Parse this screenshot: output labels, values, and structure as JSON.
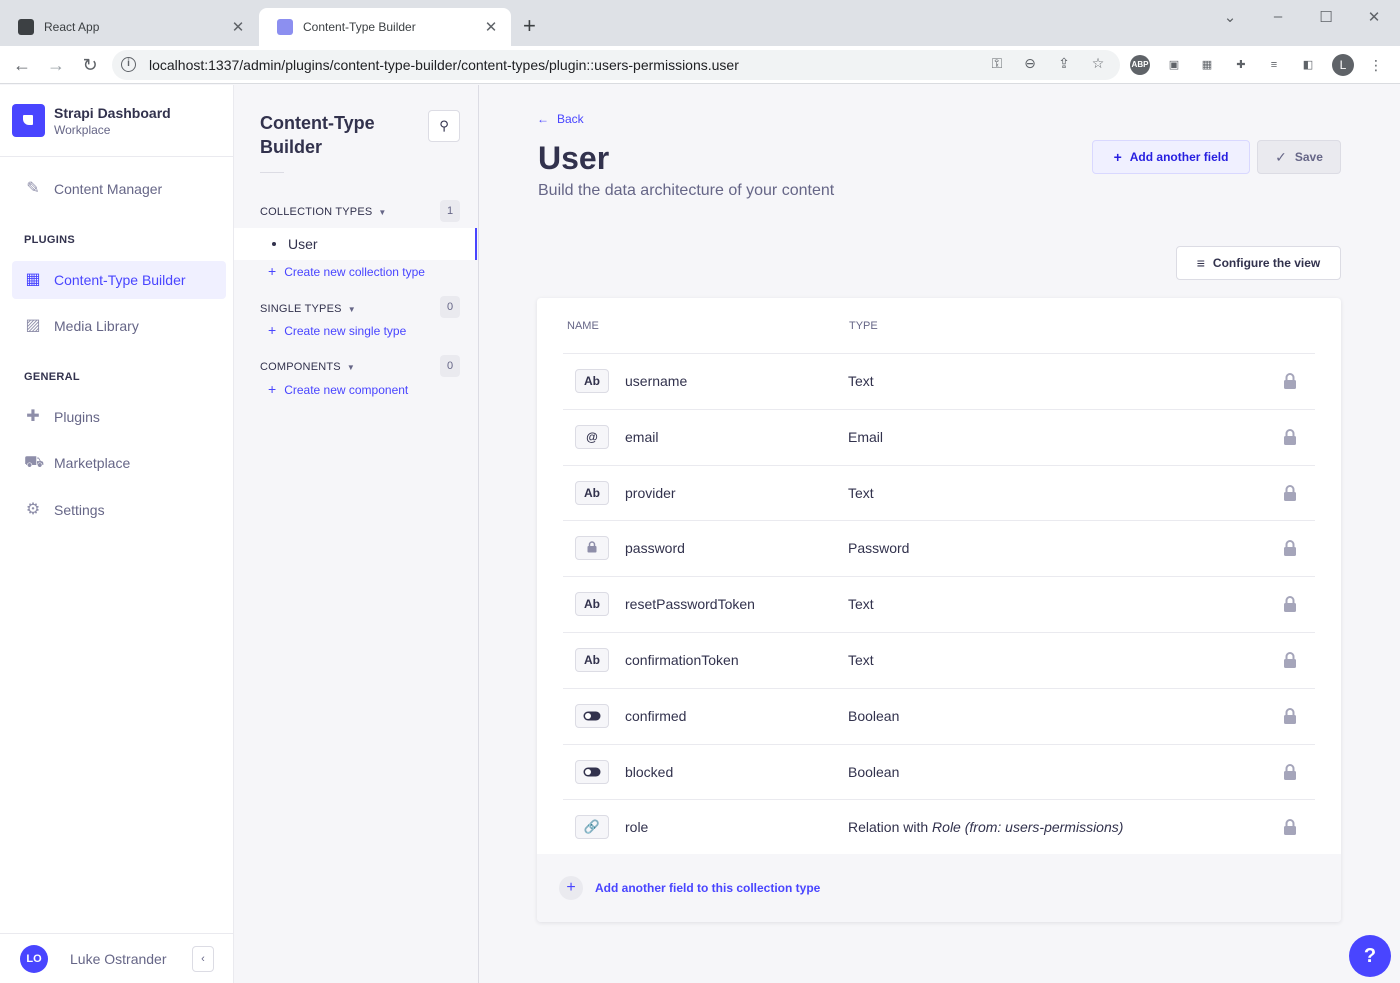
{
  "browser": {
    "tabs": [
      {
        "title": "React App"
      },
      {
        "title": "Content-Type Builder"
      }
    ],
    "url": "localhost:1337/admin/plugins/content-type-builder/content-types/plugin::users-permissions.user",
    "profile_initial": "L"
  },
  "mainnav": {
    "brand_title": "Strapi Dashboard",
    "brand_subtitle": "Workplace",
    "content_manager": "Content Manager",
    "plugins_section": "PLUGINS",
    "content_type_builder": "Content-Type Builder",
    "media_library": "Media Library",
    "general_section": "GENERAL",
    "plugins": "Plugins",
    "marketplace": "Marketplace",
    "settings": "Settings",
    "user_initials": "LO",
    "user_name": "Luke Ostrander"
  },
  "subnav": {
    "title": "Content-Type Builder",
    "collection_types_label": "COLLECTION TYPES",
    "collection_types_count": "1",
    "collection_items": [
      "User"
    ],
    "create_collection": "Create new collection type",
    "single_types_label": "SINGLE TYPES",
    "single_types_count": "0",
    "create_single": "Create new single type",
    "components_label": "COMPONENTS",
    "components_count": "0",
    "create_component": "Create new component"
  },
  "main": {
    "back": "Back",
    "title": "User",
    "subtitle": "Build the data architecture of your content",
    "add_field_button": "Add another field",
    "save_button": "Save",
    "configure_button": "Configure the view",
    "col_name": "NAME",
    "col_type": "TYPE",
    "fields": [
      {
        "icon": "Ab",
        "name": "username",
        "type": "Text"
      },
      {
        "icon": "@",
        "name": "email",
        "type": "Email"
      },
      {
        "icon": "Ab",
        "name": "provider",
        "type": "Text"
      },
      {
        "icon": "lock",
        "name": "password",
        "type": "Password"
      },
      {
        "icon": "Ab",
        "name": "resetPasswordToken",
        "type": "Text"
      },
      {
        "icon": "Ab",
        "name": "confirmationToken",
        "type": "Text"
      },
      {
        "icon": "toggle",
        "name": "confirmed",
        "type": "Boolean"
      },
      {
        "icon": "toggle",
        "name": "blocked",
        "type": "Boolean"
      },
      {
        "icon": "link",
        "name": "role",
        "type": "Relation with ",
        "type_target": "Role (from: users-permissions)"
      }
    ],
    "add_field_footer": "Add another field to this collection type",
    "help": "?"
  },
  "colors": {
    "primary": "#4945ff",
    "text": "#32324d",
    "muted": "#666687"
  }
}
